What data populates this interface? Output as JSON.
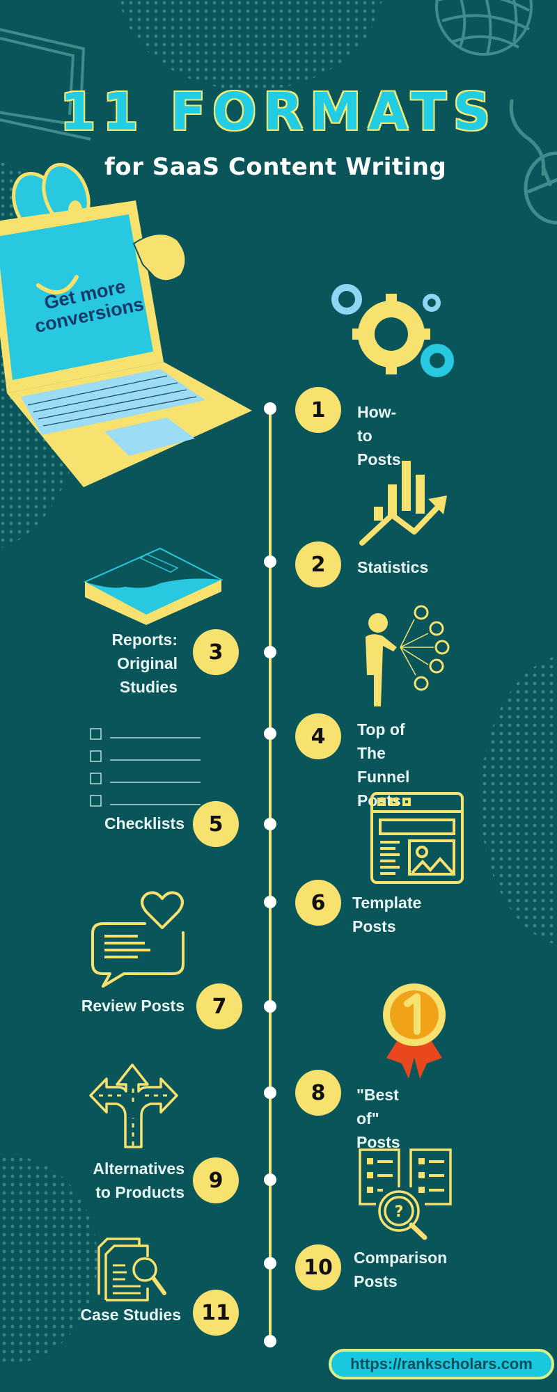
{
  "header": {
    "title": "11 FORMATS",
    "subtitle": "for SaaS Content Writing"
  },
  "hero": {
    "screen_text_line1": "Get more",
    "screen_text_line2": "conversions"
  },
  "formats": [
    {
      "number": "1",
      "label_lines": [
        "How-to Posts"
      ],
      "icon": "gears-icon",
      "side": "right"
    },
    {
      "number": "2",
      "label_lines": [
        "Statistics"
      ],
      "icon": "bar-chart-trend-icon",
      "side": "right"
    },
    {
      "number": "3",
      "label_lines": [
        "Reports:",
        "Original",
        "Studies"
      ],
      "icon": "report-book-icon",
      "side": "left"
    },
    {
      "number": "4",
      "label_lines": [
        "Top of The",
        "Funnel Posts"
      ],
      "icon": "person-broadcast-icon",
      "side": "right"
    },
    {
      "number": "5",
      "label_lines": [
        "Checklists"
      ],
      "icon": "checklist-icon",
      "side": "left"
    },
    {
      "number": "6",
      "label_lines": [
        "Template Posts"
      ],
      "icon": "webpage-template-icon",
      "side": "right"
    },
    {
      "number": "7",
      "label_lines": [
        "Review Posts"
      ],
      "icon": "chat-heart-icon",
      "side": "left"
    },
    {
      "number": "8",
      "label_lines": [
        "\"Best of\" Posts"
      ],
      "icon": "medal-icon",
      "side": "right"
    },
    {
      "number": "9",
      "label_lines": [
        "Alternatives",
        "to Products"
      ],
      "icon": "road-fork-arrows-icon",
      "side": "left"
    },
    {
      "number": "10",
      "label_lines": [
        "Comparison",
        "Posts"
      ],
      "icon": "compare-documents-search-icon",
      "side": "right"
    },
    {
      "number": "11",
      "label_lines": [
        "Case Studies"
      ],
      "icon": "documents-magnifier-icon",
      "side": "left"
    }
  ],
  "footer": {
    "url": "https://rankscholars.com"
  },
  "colors": {
    "background": "#0a5559",
    "accent_yellow": "#f7e16f",
    "accent_cyan": "#22cde3",
    "text_light": "#e8f6f4",
    "decor_teal": "#3f8c8c"
  }
}
